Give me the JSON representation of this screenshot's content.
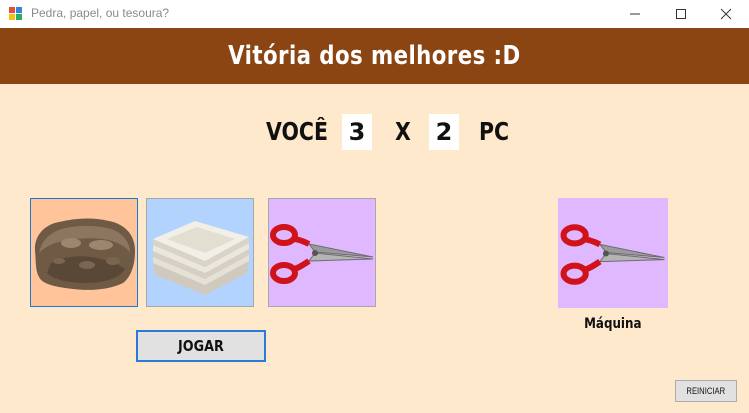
{
  "window": {
    "title": "Pedra, papel, ou tesoura?"
  },
  "banner": {
    "text": "Vitória dos melhores :D"
  },
  "score": {
    "player_label": "VOCÊ",
    "player_score": "3",
    "separator": "X",
    "pc_score": "2",
    "pc_label": "PC"
  },
  "choices": [
    {
      "name": "pedra",
      "icon": "rock-icon",
      "bg": "#ffc49a",
      "selected": true
    },
    {
      "name": "papel",
      "icon": "paper-icon",
      "bg": "#b3d3ff",
      "selected": false
    },
    {
      "name": "tesoura",
      "icon": "scissors-icon",
      "bg": "#e0b8ff",
      "selected": false
    }
  ],
  "machine": {
    "label": "Máquina",
    "choice_icon": "scissors-icon",
    "bg": "#e0b8ff"
  },
  "buttons": {
    "play": "JOGAR",
    "restart": "REINICIAR"
  },
  "colors": {
    "banner": "#8b4513",
    "background": "#ffe9cc",
    "accent_border": "#2b7bd6"
  }
}
